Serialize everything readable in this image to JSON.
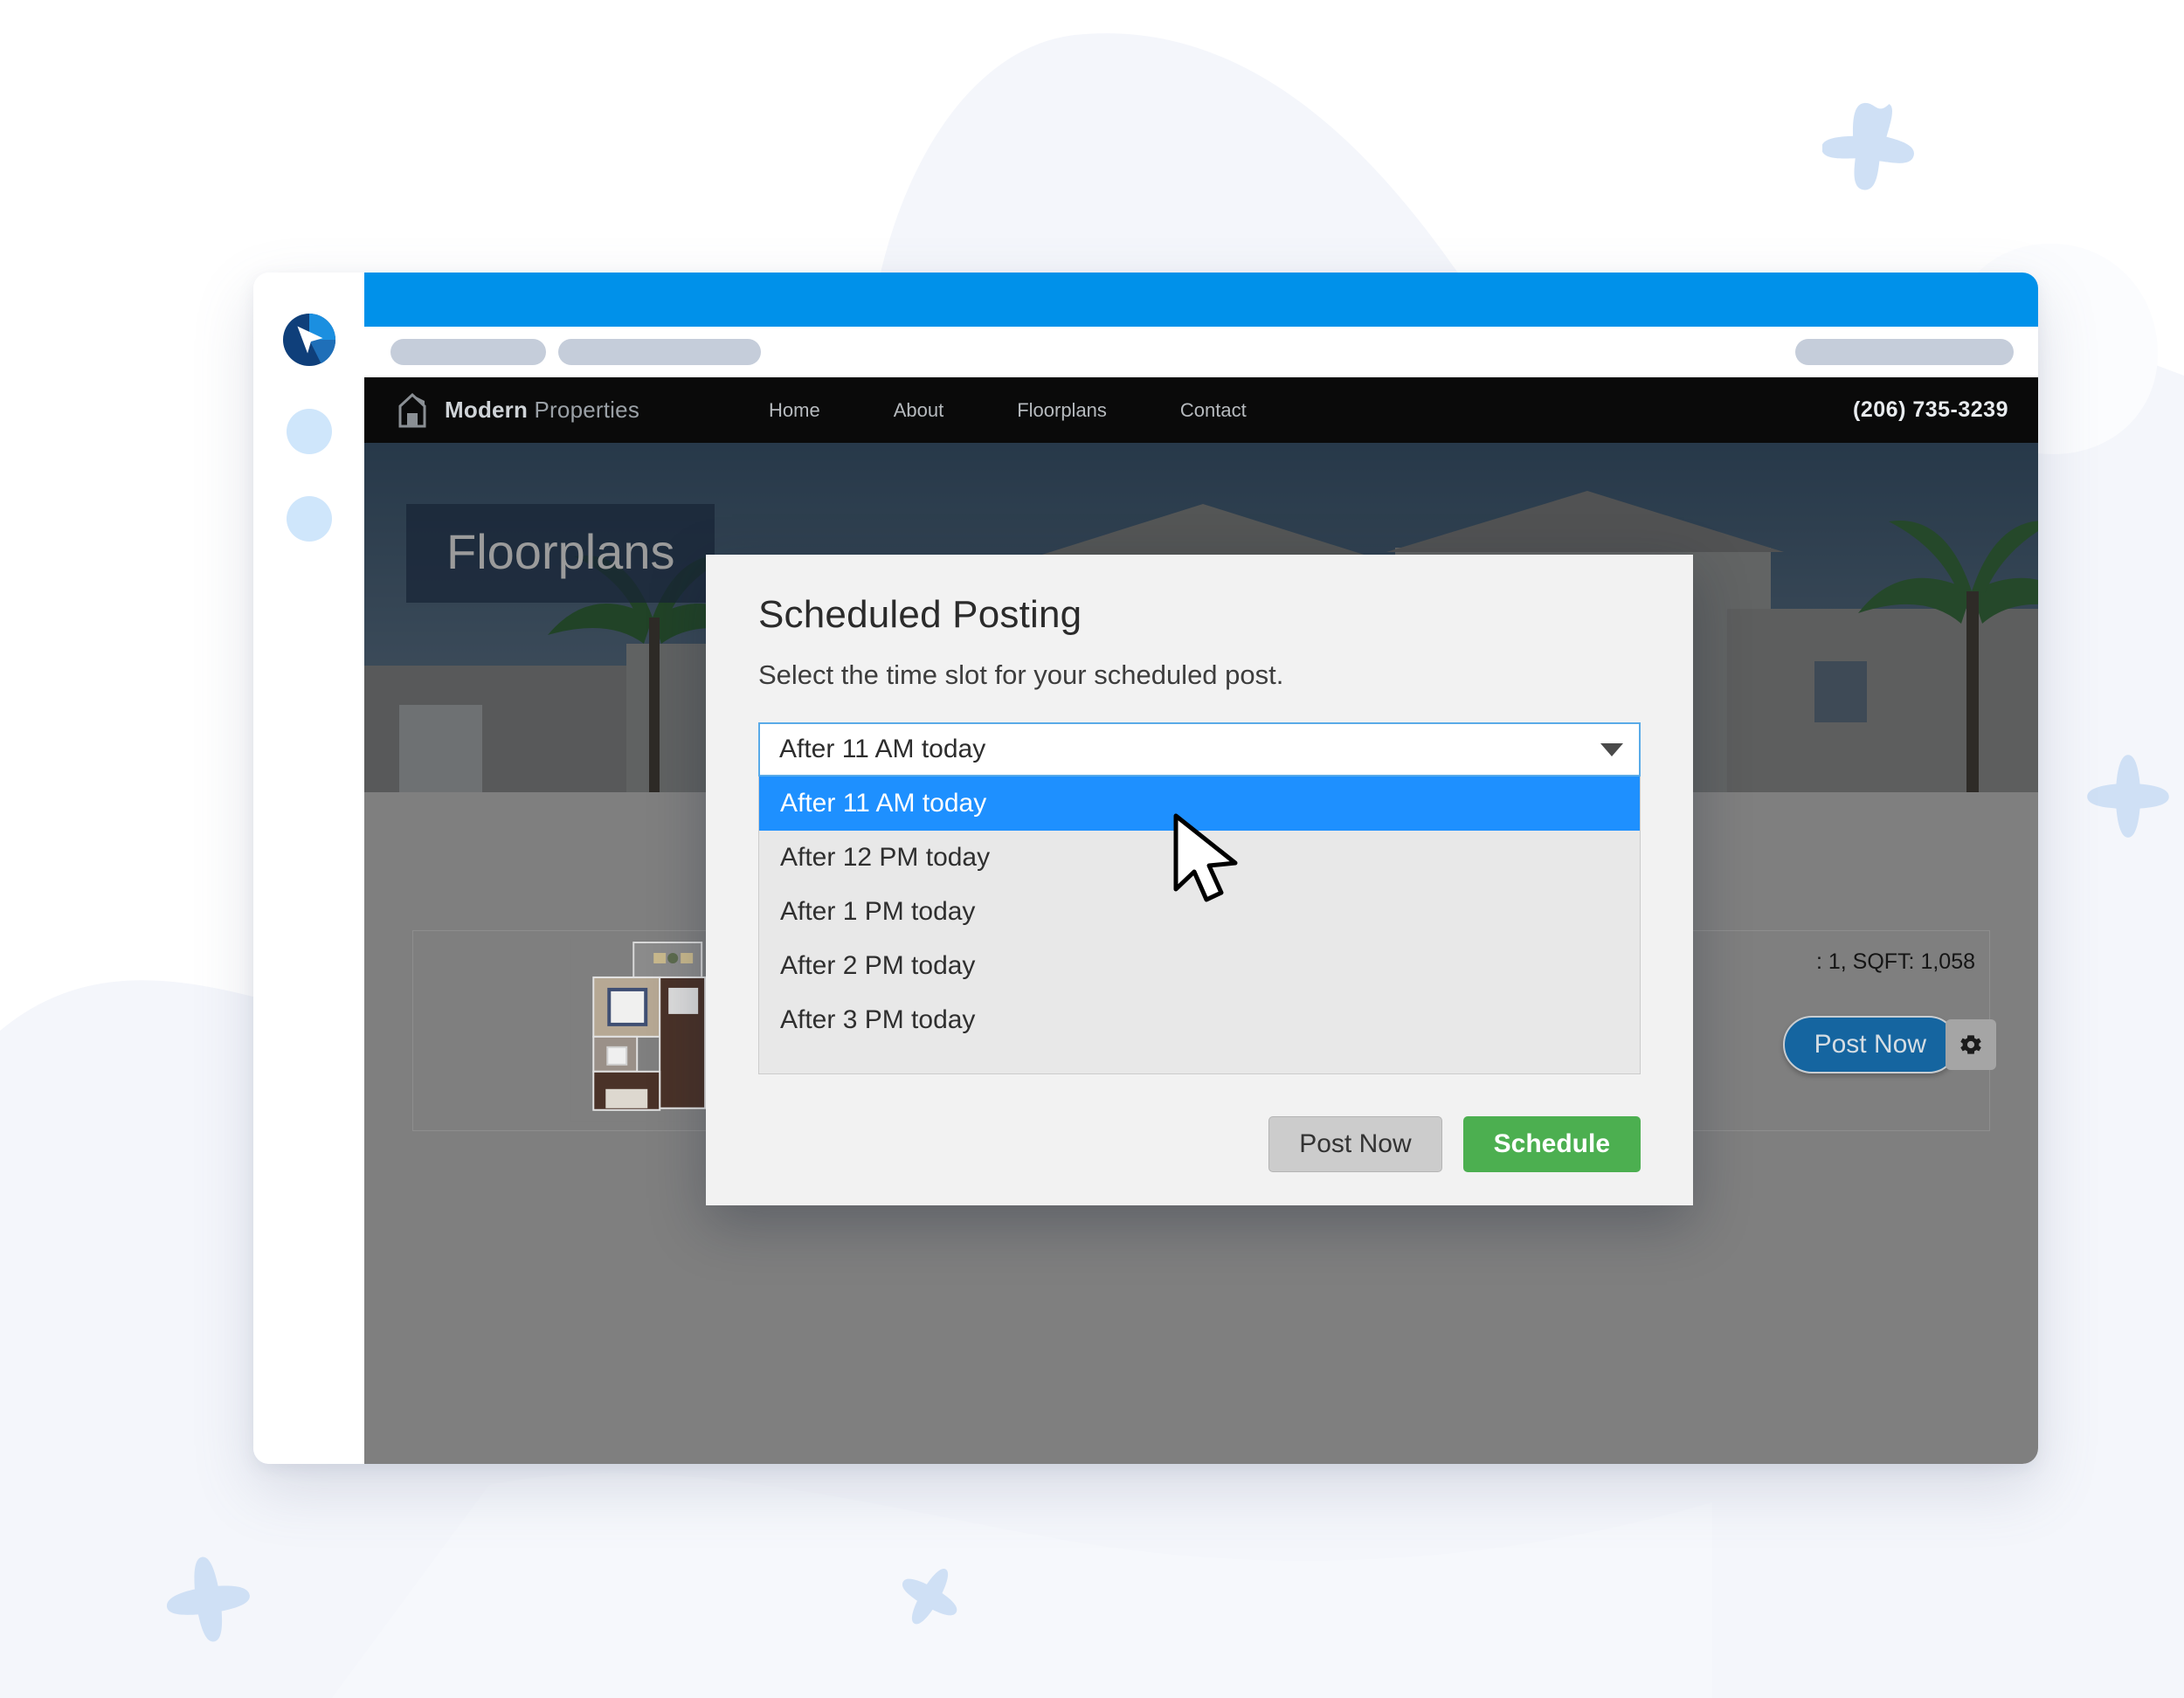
{
  "colors": {
    "accent_blue": "#0091ea",
    "highlight_blue": "#1e90ff",
    "schedule_green": "#4caf50",
    "post_now_blue": "#1565a0",
    "sparkle_blue": "#cfe0f5",
    "rail_dot_blue": "#cfe6fb"
  },
  "app_rail": {
    "logo_name": "cursor-logo-icon",
    "dots": [
      "rail-dot-1",
      "rail-dot-2"
    ]
  },
  "browser": {
    "top_bar_color": "#0091ea",
    "toolbar_pills": [
      "pill-left",
      "pill-middle",
      "pill-right"
    ]
  },
  "site": {
    "brand": {
      "icon": "house-icon",
      "bold": "Modern",
      "light": " Properties"
    },
    "nav_links": [
      "Home",
      "About",
      "Floorplans",
      "Contact"
    ],
    "phone": "(206) 735-3239",
    "hero_title": "Floorplans"
  },
  "listing": {
    "cards": [
      {
        "name": "floorplan-card-1",
        "image": "floorplan-thumbnail"
      },
      {
        "name": "floorplan-card-2",
        "image": "floorplan-thumbnail"
      },
      {
        "name": "floorplan-card-3",
        "image": "floorplan-thumbnail"
      }
    ],
    "meta_text": ": 1, SQFT: 1,058",
    "post_now_label": "Post Now",
    "gear_icon": "gear-icon"
  },
  "modal": {
    "title": "Scheduled Posting",
    "subtitle": "Select the time slot for your scheduled post.",
    "select": {
      "value": "After 11 AM today",
      "arrow_icon": "chevron-down-icon",
      "options": [
        "After 11 AM today",
        "After 12 PM today",
        "After 1 PM today",
        "After 2 PM today",
        "After 3 PM today"
      ],
      "selected_index": 0
    },
    "buttons": {
      "post_now": "Post Now",
      "schedule": "Schedule"
    }
  },
  "cursor": {
    "icon": "mouse-pointer-icon"
  }
}
